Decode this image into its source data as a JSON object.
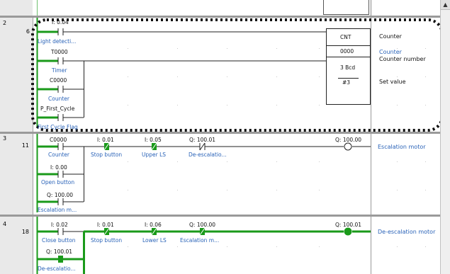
{
  "rungs": [
    {
      "rung": "2",
      "step": "6"
    },
    {
      "rung": "3",
      "step": "11"
    },
    {
      "rung": "4",
      "step": "18"
    }
  ],
  "rung2": {
    "contacts": [
      {
        "address": "I: 0.04",
        "label": "Light detecti..."
      },
      {
        "address": "T0000",
        "label": "Timer"
      },
      {
        "address": "C0000",
        "label": "Counter"
      },
      {
        "address": "P_First_Cycle",
        "label": "First Cycle Flag"
      }
    ],
    "block": {
      "name": "CNT",
      "operand1": "0000",
      "operand2_line1": "3 Bcd",
      "operand2_line2": "#3"
    },
    "comments": {
      "name": "Counter",
      "operand1_label": "Counter",
      "operand1_desc": "Counter number",
      "operand2": "Set value"
    }
  },
  "rung3": {
    "contacts": [
      {
        "address": "C0000",
        "label": "Counter"
      },
      {
        "address": "I: 0.01",
        "label": "Stop button"
      },
      {
        "address": "I: 0.05",
        "label": "Upper LS"
      },
      {
        "address": "Q: 100.01",
        "label": "De-escalatio..."
      },
      {
        "address": "I: 0.00",
        "label": "Open button"
      },
      {
        "address": "Q: 100.00",
        "label": "Escalation m..."
      }
    ],
    "coil": {
      "address": "Q: 100.00",
      "label": "Escalation motor"
    }
  },
  "rung4": {
    "contacts": [
      {
        "address": "I: 0.02",
        "label": "Close button"
      },
      {
        "address": "I: 0.01",
        "label": "Stop button"
      },
      {
        "address": "I: 0.06",
        "label": "Lower LS"
      },
      {
        "address": "Q: 100.00",
        "label": "Escalation m..."
      },
      {
        "address": "Q: 100.01",
        "label": "De-escalatio..."
      }
    ],
    "coil": {
      "address": "Q: 100.01",
      "label": "De-escalation motor"
    }
  },
  "colors": {
    "power": "#1a9a1a",
    "label": "#2a63b8",
    "highlight": "#111111"
  },
  "scrollbar": {
    "up_arrow": "up-arrow-icon"
  }
}
